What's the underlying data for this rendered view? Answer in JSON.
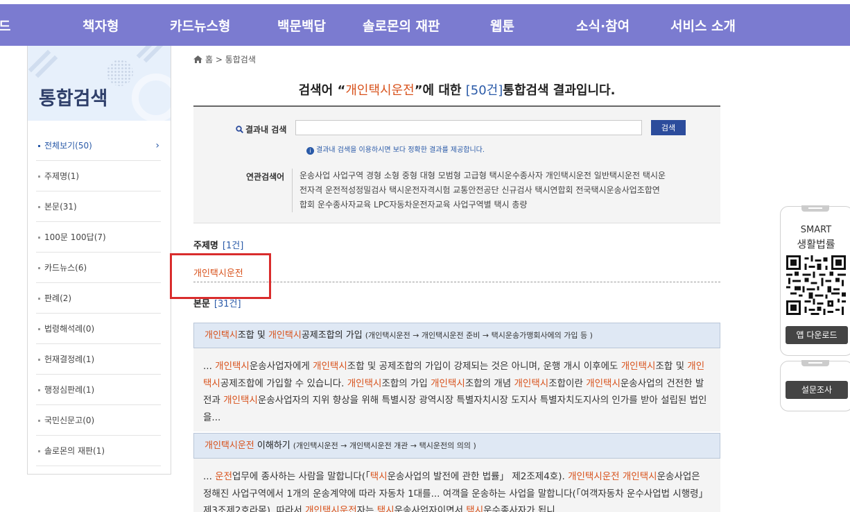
{
  "nav": {
    "edge_label": "드",
    "items": [
      "책자형",
      "카드뉴스형",
      "백문백답",
      "솔로몬의 재판",
      "웹툰",
      "소식·참여",
      "서비스 소개"
    ]
  },
  "sidebar": {
    "title": "통합검색",
    "items": [
      {
        "label": "전체보기(50)",
        "active": true
      },
      {
        "label": "주제명(1)"
      },
      {
        "label": "본문(31)"
      },
      {
        "label": "100문 100답(7)"
      },
      {
        "label": "카드뉴스(6)"
      },
      {
        "label": "판례(2)"
      },
      {
        "label": "법령해석례(0)"
      },
      {
        "label": "헌재결정례(1)"
      },
      {
        "label": "행정심판례(1)"
      },
      {
        "label": "국민신문고(0)"
      },
      {
        "label": "솔로몬의 재판(1)"
      }
    ],
    "chevron": "›"
  },
  "breadcrumb": {
    "text": "홈 > 통합검색"
  },
  "headline": {
    "prefix": "검색어 “",
    "keyword": "개인택시운전",
    "middle": "”에 대한 ",
    "count": "[50건]",
    "suffix": "통합검색 결과입니다."
  },
  "search": {
    "label": "결과내 검색",
    "input_value": "",
    "button": "검색",
    "note": "결과내 검색을 이용하시면 보다 정확한 결과를 제공합니다.",
    "related_label": "연관검색어",
    "related_terms": [
      "운송사업",
      "사업구역",
      "경형",
      "소형",
      "중형",
      "대형",
      "모범형",
      "고급형",
      "택시운수종사자",
      "개인택시운전",
      "일반택시운전",
      "택시운전자격",
      "운전적성정밀검사",
      "택시운전자격시험",
      "교통안전공단",
      "신규검사",
      "택시연합회",
      "전국택시운송사업조합연합회",
      "운수종사자교육",
      "LPC자동차운전자교육",
      "사업구역별 택시 총량"
    ]
  },
  "section_topic": {
    "title": "주제명",
    "count": "[1건]",
    "link": "개인택시운전"
  },
  "section_body": {
    "title": "본문",
    "count": "[31건]",
    "results": [
      {
        "title": [
          {
            "t": "개인택시",
            "h": true
          },
          {
            "t": "조합 및 "
          },
          {
            "t": "개인택시",
            "h": true
          },
          {
            "t": "공제조합의 가입"
          }
        ],
        "path": "(개인택시운전 → 개인택시운전 준비 → 택시운송가맹회사에의 가입 등 )",
        "body": [
          {
            "t": "... "
          },
          {
            "t": "개인택시",
            "h": true
          },
          {
            "t": "운송사업자에게 "
          },
          {
            "t": "개인택시",
            "h": true
          },
          {
            "t": "조합 및 공제조합의 가입이 강제되는 것은 아니며, 운행 개시 이후에도 "
          },
          {
            "t": "개인택시",
            "h": true
          },
          {
            "t": "조합 및 "
          },
          {
            "t": "개인택시",
            "h": true
          },
          {
            "t": "공제조합에 가입할 수 있습니다. "
          },
          {
            "t": "개인택시",
            "h": true
          },
          {
            "t": "조합의 가입 "
          },
          {
            "t": "개인택시",
            "h": true
          },
          {
            "t": "조합의 개념 "
          },
          {
            "t": "개인택시",
            "h": true
          },
          {
            "t": "조합이란 "
          },
          {
            "t": "개인택시",
            "h": true
          },
          {
            "t": "운송사업의 건전한 발전과 "
          },
          {
            "t": "개인택시",
            "h": true
          },
          {
            "t": "운송사업자의 지위 향상을 위해 특별시장 광역시장 특별자치시장 도지사 특별자치도지사의 인가를 받아 설립된 법인을..."
          }
        ]
      },
      {
        "title": [
          {
            "t": "개인택시운전",
            "h": true
          },
          {
            "t": " 이해하기"
          }
        ],
        "path": "(개인택시운전 → 개인택시운전 개관 → 택시운전의 의의 )",
        "body": [
          {
            "t": "... "
          },
          {
            "t": "운전",
            "h": true
          },
          {
            "t": "업무에 종사하는 사람을 말합니다(「"
          },
          {
            "t": "택시",
            "h": true
          },
          {
            "t": "운송사업의 발전에 관한 법률」 제2조제4호). "
          },
          {
            "t": "개인택시운전",
            "h": true
          },
          {
            "t": " "
          },
          {
            "t": "개인택시",
            "h": true
          },
          {
            "t": "운송사업은 정해진 사업구역에서 1개의 운송계약에 따라 자동차 1대를... 여객을 운송하는 사업을 말합니다(「여객자동차 운수사업법 시행령」 제3조제2호라목). 따라서 "
          },
          {
            "t": "개인택시운전",
            "h": true
          },
          {
            "t": "자는 "
          },
          {
            "t": "택시",
            "h": true
          },
          {
            "t": "운송사업자이면서 "
          },
          {
            "t": "택시",
            "h": true
          },
          {
            "t": "운수종사자가 됩니"
          }
        ]
      }
    ]
  },
  "widget": {
    "line1": "SMART",
    "line2": "생활법률",
    "app_button": "앱 다운로드",
    "survey_button": "설문조사"
  },
  "colors": {
    "nav": "#7b7bd0",
    "highlight": "#d8521c",
    "accent": "#2a5aa8",
    "annotation_box": "#d92c2c"
  }
}
